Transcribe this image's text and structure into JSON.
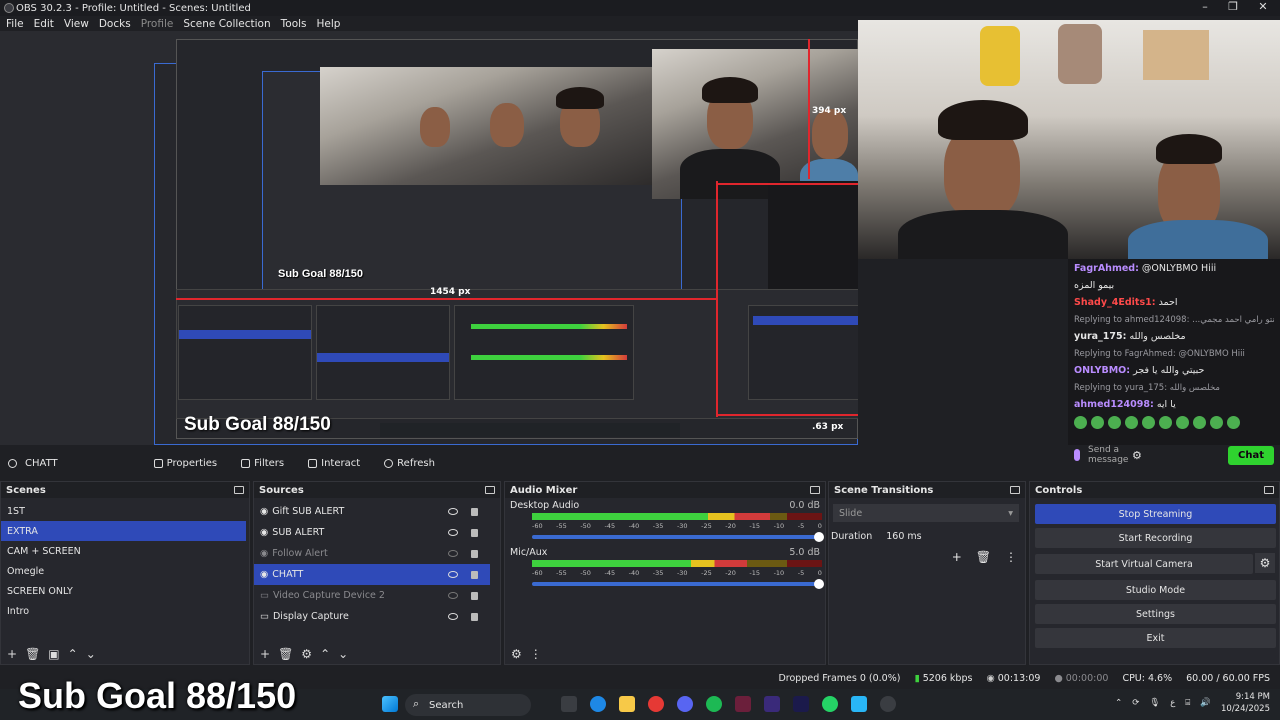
{
  "window": {
    "title": "OBS 30.2.3 - Profile: Untitled - Scenes: Untitled",
    "minimize": "–",
    "maximize": "❐",
    "close": "✕"
  },
  "menu": [
    "File",
    "Edit",
    "View",
    "Docks",
    "Profile",
    "Scene Collection",
    "Tools",
    "Help"
  ],
  "preview": {
    "measure_top": "394 px",
    "measure_mid": "1454 px",
    "measure_bottom": ".63 px",
    "nested_subgoal": "Sub Goal 88/150",
    "nested_subgoal_big": "Sub Goal 88/150"
  },
  "chat": {
    "messages": [
      {
        "user": "FagrAhmed:",
        "text": "@ONLYBMO Hiii",
        "user_color": "#b98cff"
      },
      {
        "user": "",
        "text": "بيمو المزه",
        "user_color": "#ffffff"
      },
      {
        "user": "Shady_4Edits1:",
        "text": "احمد",
        "user_color": "#ff4a4a"
      },
      {
        "reply": "Replying to ahmed124098: ...بس انتو رامي احمد مجمي"
      },
      {
        "user": "yura_175:",
        "text": "مخلصس والله",
        "user_color": "#e6e6e6"
      },
      {
        "reply": "Replying to FagrAhmed: @ONLYBMO Hiii"
      },
      {
        "user": "ONLYBMO:",
        "text": "حبيتي والله يا فجر",
        "user_color": "#b98cff"
      },
      {
        "reply": "Replying to yura_175: مخلصس والله"
      },
      {
        "user": "ahmed124098:",
        "text": "يا ايه",
        "user_color": "#b98cff"
      }
    ],
    "input_placeholder": "Send a message",
    "chat_button": "Chat"
  },
  "context_bar": {
    "source_name": "CHATT",
    "properties": "Properties",
    "filters": "Filters",
    "interact": "Interact",
    "refresh": "Refresh"
  },
  "scenes": {
    "title": "Scenes",
    "items": [
      "1ST",
      "EXTRA",
      "CAM + SCREEN",
      "Omegle",
      "SCREEN ONLY",
      "Intro"
    ],
    "selected": "EXTRA"
  },
  "sources": {
    "title": "Sources",
    "items": [
      {
        "name": "Gift SUB ALERT",
        "visible": true,
        "icon": "browser-icon"
      },
      {
        "name": "SUB ALERT",
        "visible": true,
        "icon": "browser-icon"
      },
      {
        "name": "Follow Alert",
        "visible": false,
        "icon": "browser-icon"
      },
      {
        "name": "CHATT",
        "visible": true,
        "icon": "browser-icon",
        "selected": true
      },
      {
        "name": "Video Capture Device 2",
        "visible": false,
        "icon": "camera-icon"
      },
      {
        "name": "Display Capture",
        "visible": true,
        "icon": "monitor-icon"
      }
    ]
  },
  "audio_mixer": {
    "title": "Audio Mixer",
    "channels": [
      {
        "name": "Desktop Audio",
        "db": "0.0 dB",
        "level": 0.82
      },
      {
        "name": "Mic/Aux",
        "db": "5.0 dB",
        "level": 0.74
      }
    ],
    "ticks": [
      "-60",
      "-55",
      "-50",
      "-45",
      "-40",
      "-35",
      "-30",
      "-25",
      "-20",
      "-15",
      "-10",
      "-5",
      "0"
    ]
  },
  "transitions": {
    "title": "Scene Transitions",
    "selected": "Slide",
    "duration_label": "Duration",
    "duration_value": "160 ms"
  },
  "controls": {
    "title": "Controls",
    "buttons": [
      "Stop Streaming",
      "Start Recording",
      "Start Virtual Camera",
      "Studio Mode",
      "Settings",
      "Exit"
    ]
  },
  "status": {
    "dropped": "Dropped Frames 0 (0.0%)",
    "bitrate": "5206 kbps",
    "stream_time": "00:13:09",
    "record_time": "00:00:00",
    "cpu": "CPU: 4.6%",
    "fps": "60.00 / 60.00 FPS"
  },
  "overlay": {
    "subgoal": "Sub Goal 88/150"
  },
  "taskbar": {
    "search": "Search",
    "time": "9:14 PM",
    "date": "10/24/2025",
    "lang": "ع"
  }
}
